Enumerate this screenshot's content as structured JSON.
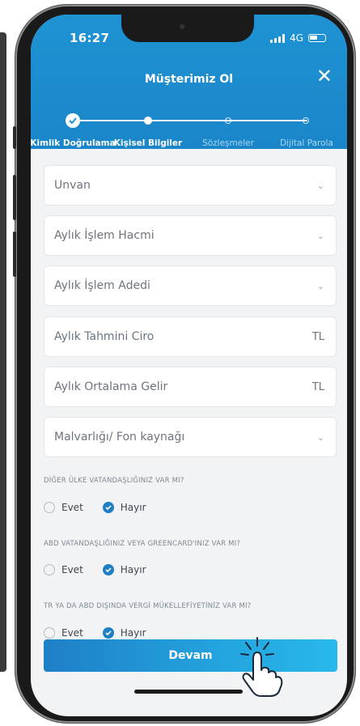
{
  "status_bar": {
    "time": "16:27",
    "network": "4G"
  },
  "header": {
    "title": "Müşterimiz Ol",
    "close_label": "✕"
  },
  "steps": [
    {
      "label": "Kimlik Doğrulama",
      "state": "done"
    },
    {
      "label": "Kişisel Bilgiler",
      "state": "current"
    },
    {
      "label": "Sözleşmeler",
      "state": "pending"
    },
    {
      "label": "Dijital Parola",
      "state": "pending"
    }
  ],
  "fields": [
    {
      "label": "Unvan",
      "type": "select"
    },
    {
      "label": "Aylık İşlem Hacmi",
      "type": "select"
    },
    {
      "label": "Aylık İşlem Adedi",
      "type": "select"
    },
    {
      "label": "Aylık Tahmini Ciro",
      "type": "currency",
      "suffix": "TL"
    },
    {
      "label": "Aylık Ortalama Gelir",
      "type": "currency",
      "suffix": "TL"
    },
    {
      "label": "Malvarlığı/ Fon kaynağı",
      "type": "select"
    }
  ],
  "questions": [
    {
      "text": "DİĞER ÜLKE VATANDAŞLIĞINIZ VAR MI?",
      "options": [
        "Evet",
        "Hayır"
      ],
      "selected": "Hayır"
    },
    {
      "text": "ABD VATANDAŞLIĞINIZ VEYA GREENCARD'INIZ VAR MI?",
      "options": [
        "Evet",
        "Hayır"
      ],
      "selected": "Hayır"
    },
    {
      "text": "TR YA DA ABD DIŞINDA VERGİ MÜKELLEFİYETİNİZ VAR MI?",
      "options": [
        "Evet",
        "Hayır"
      ],
      "selected": "Hayır"
    }
  ],
  "cta": {
    "label": "Devam"
  },
  "colors": {
    "brand": "#1e93d3",
    "accent": "#1e7fc4",
    "background": "#f2f3f5"
  }
}
